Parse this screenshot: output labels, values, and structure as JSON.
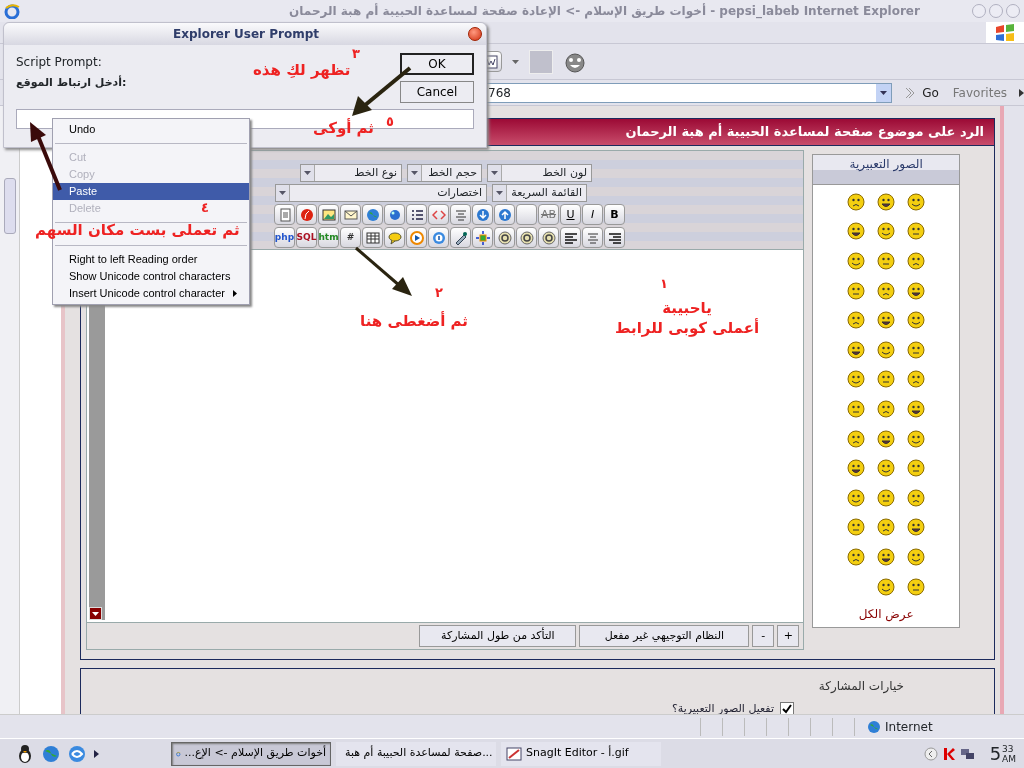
{
  "window": {
    "title": "أخوات طريق الإسلام -> الإعادة صفحة لمساعدة الحبيبة أم هبة الرحمان - pepsi_labeb Internet Explorer"
  },
  "address_bar": {
    "value": "768",
    "go": "Go",
    "favorites": "Favorites"
  },
  "page": {
    "header": "الرد على موضوع صفحة لمساعدة الحبيبة أم هبة الرحمان",
    "editor": {
      "dropdown_rows": [
        [
          {
            "label": "لون الخط"
          },
          {
            "label": "حجم الخط"
          },
          {
            "label": "نوع الخط"
          }
        ],
        [
          {
            "label": "القائمة السريعة"
          },
          {
            "label": "اختصارات"
          }
        ]
      ],
      "toolbar_rows": [
        [
          {
            "kind": "text",
            "label": "B",
            "bold": true
          },
          {
            "kind": "text",
            "label": "I",
            "italic": true
          },
          {
            "kind": "text",
            "label": "U",
            "underline": true
          },
          {
            "kind": "text",
            "label": "AB",
            "strike": true
          },
          {
            "kind": "blank"
          },
          {
            "kind": "up"
          },
          {
            "kind": "down"
          },
          {
            "kind": "align-center"
          },
          {
            "kind": "arrows"
          },
          {
            "kind": "list"
          },
          {
            "kind": "ball"
          },
          {
            "kind": "globe"
          },
          {
            "kind": "mail"
          },
          {
            "kind": "image"
          },
          {
            "kind": "flash"
          },
          {
            "kind": "document"
          }
        ],
        [
          {
            "kind": "align-right"
          },
          {
            "kind": "align-center"
          },
          {
            "kind": "align-left"
          },
          {
            "kind": "coin"
          },
          {
            "kind": "coin"
          },
          {
            "kind": "coin"
          },
          {
            "kind": "move"
          },
          {
            "kind": "pen"
          },
          {
            "kind": "info"
          },
          {
            "kind": "player"
          },
          {
            "kind": "chat"
          },
          {
            "kind": "table"
          },
          {
            "kind": "text",
            "label": "#",
            "color": "#333333"
          },
          {
            "kind": "text",
            "label": "htm",
            "color": "#228822"
          },
          {
            "kind": "text",
            "label": "SQL",
            "color": "#aa1122"
          },
          {
            "kind": "text",
            "label": "php",
            "color": "#2255cc"
          }
        ]
      ],
      "buttons": [
        "+",
        "-",
        "النظام التوجيهي غير مفعل",
        "التأكد من طول المشاركة"
      ]
    },
    "smilies": {
      "title": "الصور التعبيرية",
      "show_all": "عرض الكل"
    },
    "options": {
      "title": "خيارات المشاركة",
      "items": [
        {
          "label": "تفعيل الصور التعبيرية؟",
          "checked": true
        }
      ]
    }
  },
  "status_bar": {
    "zone": "Internet"
  },
  "taskbar": {
    "tasks": [
      {
        "kind": "editor",
        "label": "SnagIt Editor - أ.gif",
        "selected": false
      },
      {
        "kind": "browser",
        "label": "صفحة لمساعدة الحبيبة أم هبة...",
        "selected": false
      },
      {
        "kind": "browser",
        "label": "...أخوات طريق الإسلام -> الإع",
        "selected": true
      }
    ],
    "clock": {
      "hour": "5",
      "minutes": "33",
      "period": "AM"
    }
  },
  "dialog": {
    "title": "Explorer User Prompt",
    "caption": "Script Prompt:",
    "prompt": "أدخل ارتباط الموقع:",
    "buttons": [
      {
        "label": "OK",
        "default": true
      },
      {
        "label": "Cancel",
        "default": false
      }
    ]
  },
  "context_menu": {
    "items": [
      {
        "kind": "item",
        "label": "Undo",
        "disabled": false,
        "selected": false
      },
      {
        "kind": "separator"
      },
      {
        "kind": "item",
        "label": "Cut",
        "disabled": true,
        "selected": false
      },
      {
        "kind": "item",
        "label": "Copy",
        "disabled": true,
        "selected": false
      },
      {
        "kind": "item",
        "label": "Paste",
        "disabled": false,
        "selected": true
      },
      {
        "kind": "item",
        "label": "Delete",
        "disabled": true,
        "selected": false
      },
      {
        "kind": "separator"
      },
      {
        "kind": "separator"
      },
      {
        "kind": "item",
        "label": "Right to left Reading order",
        "disabled": false,
        "selected": false
      },
      {
        "kind": "item",
        "label": "Show Unicode control characters",
        "disabled": false,
        "selected": false
      },
      {
        "kind": "submenu",
        "label": "Insert Unicode control character",
        "disabled": false,
        "selected": false
      }
    ]
  },
  "annotations": [
    {
      "number": "١",
      "lines": [
        "ياحبيبة",
        "أعملى كوبى للرابط"
      ]
    },
    {
      "number": "٢",
      "lines": [
        "ثم أضغطى هنا"
      ]
    },
    {
      "number": "٣",
      "lines": [
        "تظهر لكِ هذه"
      ]
    },
    {
      "number": "٤",
      "lines": [
        "ثم تعملى بست مكان السهم"
      ]
    },
    {
      "number": "٥",
      "lines": [
        "ثم أوكى"
      ]
    }
  ]
}
